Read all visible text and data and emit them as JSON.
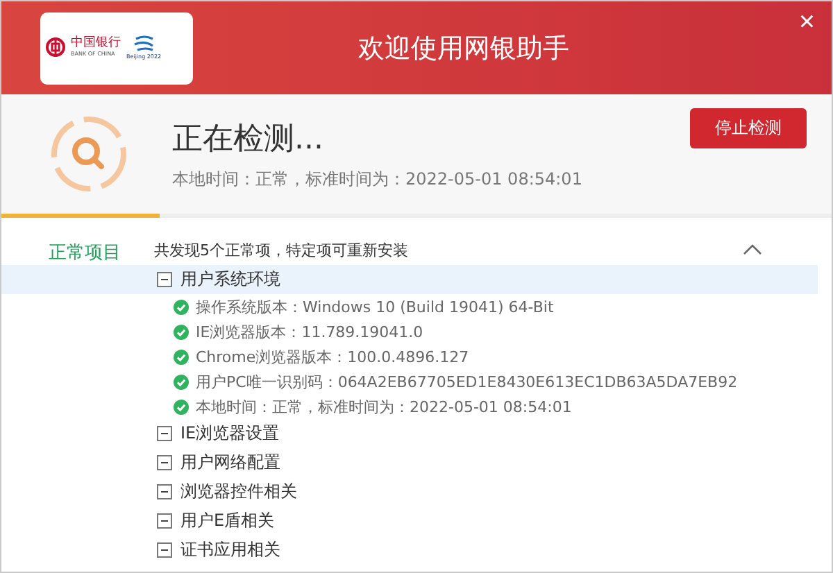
{
  "header": {
    "logo": {
      "bank_name": "中国银行",
      "bank_name_en": "BANK OF CHINA",
      "games": "Beijing 2022"
    },
    "title": "欢迎使用网银助手",
    "close": "×"
  },
  "status": {
    "title": "正在检测...",
    "subtitle": "本地时间：正常，标准时间为：2022-05-01 08:54:01",
    "button": "停止检测",
    "level": 0.19
  },
  "section": {
    "label": "正常项目",
    "summary": "共发现5个正常项，特定项可重新安装",
    "expanded": true,
    "groups": [
      {
        "label": "用户系统环境",
        "expanded": true,
        "selected": true,
        "children": [
          {
            "label": "操作系统版本：Windows 10  (Build 19041) 64-Bit",
            "passed": true
          },
          {
            "label": "IE浏览器版本：11.789.19041.0",
            "passed": true
          },
          {
            "label": "Chrome浏览器版本：100.0.4896.127",
            "passed": true
          },
          {
            "label": "用户PC唯一识别码：064A2EB67705ED1E8430E613EC1DB63A5DA7EB92",
            "passed": true
          },
          {
            "label": "本地时间：正常，标准时间为：2022-05-01 08:54:01",
            "passed": true
          }
        ]
      },
      {
        "label": "IE浏览器设置",
        "expanded": true,
        "selected": false
      },
      {
        "label": "用户网络配置",
        "expanded": true,
        "selected": false
      },
      {
        "label": "浏览器控件相关",
        "expanded": true,
        "selected": false
      },
      {
        "label": "用户E盾相关",
        "expanded": true,
        "selected": false
      },
      {
        "label": "证书应用相关",
        "expanded": true,
        "selected": false
      }
    ]
  }
}
